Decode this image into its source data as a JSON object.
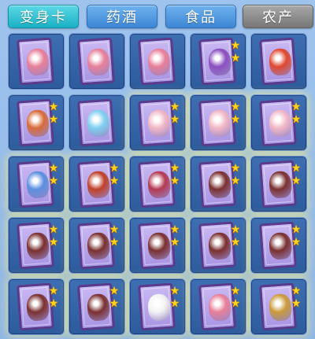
{
  "tabs": [
    {
      "label": "变身卡",
      "state": "active"
    },
    {
      "label": "药酒",
      "state": "normal"
    },
    {
      "label": "食品",
      "state": "normal"
    },
    {
      "label": "农产",
      "state": "disabled"
    }
  ],
  "colors": {
    "active_tab": "#1bb0c4",
    "tab": "#3c86d4",
    "disabled_tab": "#777777",
    "slot": "#2d5b9c",
    "card_frame": "#5a3a8a",
    "star": "#ffd21e"
  },
  "grid": {
    "rows": 5,
    "cols": 5,
    "items": [
      {
        "pet": "pink-bear",
        "color": "#e77f9a",
        "stars": 0,
        "glow": false
      },
      {
        "pet": "pink-bear",
        "color": "#e77f9a",
        "stars": 0,
        "glow": false
      },
      {
        "pet": "pink-bear",
        "color": "#e77f9a",
        "stars": 0,
        "glow": false
      },
      {
        "pet": "purple-dragon",
        "color": "#8a4fc0",
        "stars": 2,
        "glow": false
      },
      {
        "pet": "red-lion",
        "color": "#e0472e",
        "stars": 0,
        "glow": false
      },
      {
        "pet": "fox-warrior",
        "color": "#d86b3a",
        "stars": 2,
        "glow": false
      },
      {
        "pet": "ice-fairy",
        "color": "#7fd0f0",
        "stars": 0,
        "glow": false
      },
      {
        "pet": "bunny-girl",
        "color": "#f1b7c7",
        "stars": 2,
        "glow": true
      },
      {
        "pet": "bunny-girl",
        "color": "#f1b7c7",
        "stars": 2,
        "glow": true
      },
      {
        "pet": "bunny-girl",
        "color": "#f1b7c7",
        "stars": 2,
        "glow": true
      },
      {
        "pet": "blue-sprite",
        "color": "#5a8fe0",
        "stars": 2,
        "glow": true
      },
      {
        "pet": "phoenix",
        "color": "#c0402a",
        "stars": 2,
        "glow": true
      },
      {
        "pet": "armored-knight",
        "color": "#b33a52",
        "stars": 2,
        "glow": true
      },
      {
        "pet": "dark-angel",
        "color": "#7a3030",
        "stars": 2,
        "glow": true
      },
      {
        "pet": "dark-angel",
        "color": "#7a3030",
        "stars": 2,
        "glow": true
      },
      {
        "pet": "dark-angel",
        "color": "#7a3030",
        "stars": 2,
        "glow": true
      },
      {
        "pet": "dark-angel",
        "color": "#7a3030",
        "stars": 2,
        "glow": true
      },
      {
        "pet": "dark-angel",
        "color": "#7a3030",
        "stars": 2,
        "glow": true
      },
      {
        "pet": "dark-angel",
        "color": "#7a3030",
        "stars": 2,
        "glow": true
      },
      {
        "pet": "dark-angel",
        "color": "#7a3030",
        "stars": 2,
        "glow": true
      },
      {
        "pet": "dark-angel",
        "color": "#7a3030",
        "stars": 2,
        "glow": true
      },
      {
        "pet": "dark-angel",
        "color": "#7a3030",
        "stars": 2,
        "glow": true
      },
      {
        "pet": "white-bunny",
        "color": "#f3f3f3",
        "stars": 2,
        "glow": true
      },
      {
        "pet": "pink-bear",
        "color": "#e77f9a",
        "stars": 2,
        "glow": true
      },
      {
        "pet": "gold-warrior",
        "color": "#c99a3a",
        "stars": 2,
        "glow": true
      }
    ]
  }
}
